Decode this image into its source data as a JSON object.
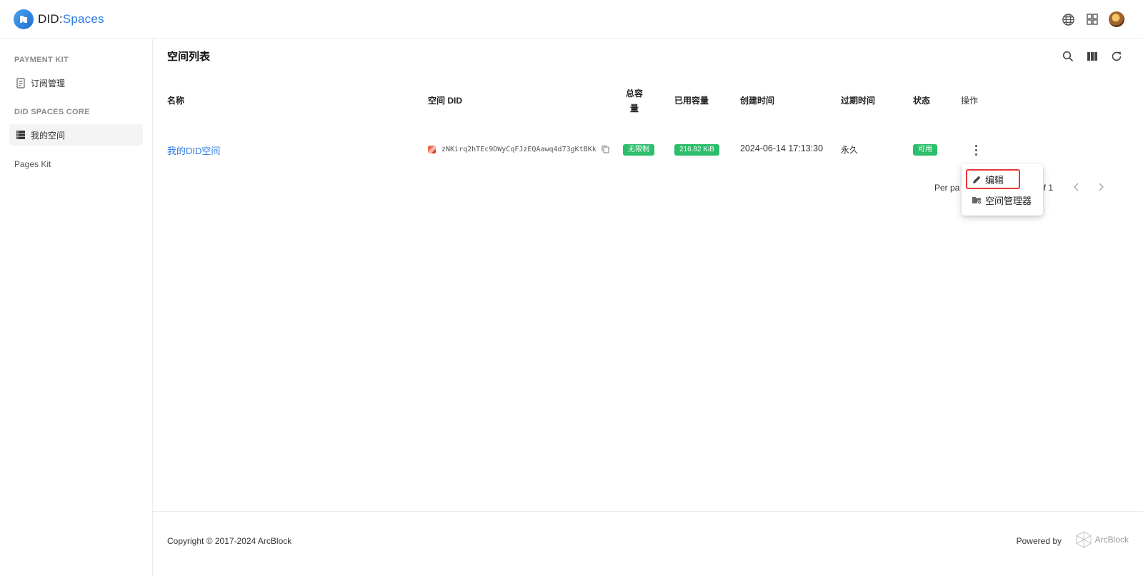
{
  "header": {
    "logo_prefix": "DID:",
    "logo_suffix": "Spaces"
  },
  "sidebar": {
    "section_payment": "PAYMENT KIT",
    "item_subscription": "订阅管理",
    "section_core": "DID SPACES CORE",
    "item_my_space": "我的空间",
    "item_pages_kit": "Pages Kit"
  },
  "main": {
    "title": "空间列表",
    "columns": {
      "name": "名称",
      "did": "空间 DID",
      "total_capacity_line1": "总容",
      "total_capacity_line2": "量",
      "used_capacity": "已用容量",
      "created_at": "创建时间",
      "expires_at": "过期时间",
      "status": "状态",
      "actions": "操作"
    },
    "row": {
      "name": "我的DID空间",
      "did": "zNKirq2hTEc9DWyCqFJzEQAawq4d73gKtBKk",
      "total_capacity": "无限制",
      "used_capacity": "216.82 KiB",
      "created_at": "2024-06-14 17:13:30",
      "expires_at": "永久",
      "status": "可用"
    },
    "pager": {
      "per_page_partial": "Per pa",
      "of_partial": "of 1"
    }
  },
  "menu": {
    "edit": "编辑",
    "space_manager": "空间管理器"
  },
  "footer": {
    "copyright": "Copyright © 2017-2024  ArcBlock",
    "powered_by": "Powered by",
    "brand": "ArcBlock"
  },
  "colors": {
    "accent": "#2c7be5",
    "badge_green": "#2cbe6b",
    "highlight_red": "#e53935"
  }
}
